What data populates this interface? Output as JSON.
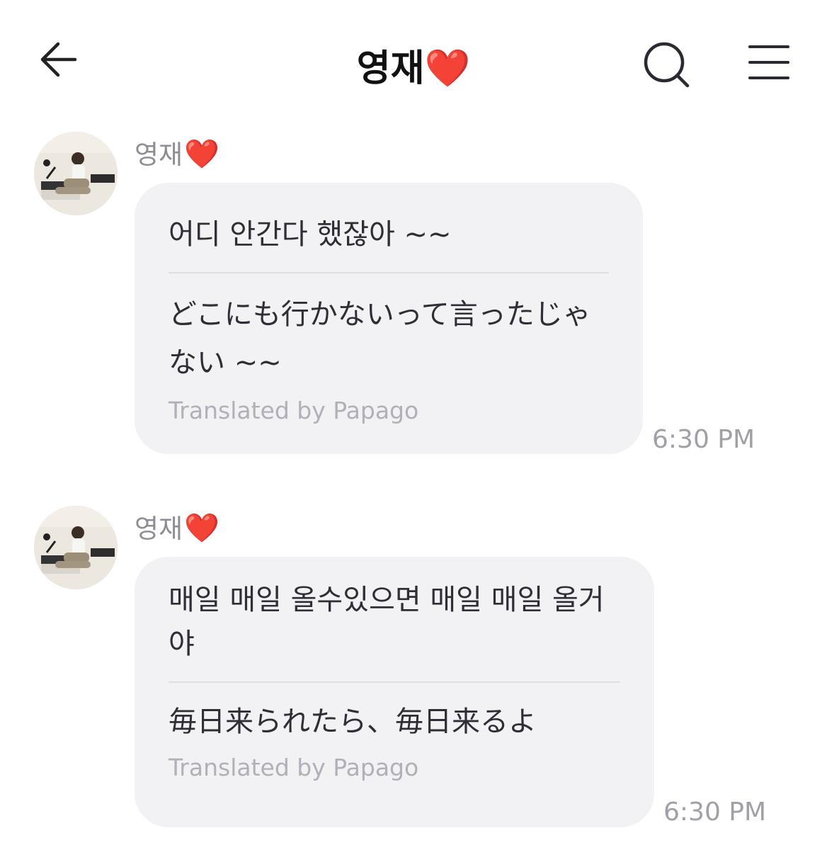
{
  "header": {
    "title": "영재",
    "title_heart": "❤️",
    "back_icon": "arrow-left",
    "search_icon": "search",
    "menu_icon": "hamburger-menu"
  },
  "messages": [
    {
      "sender_name": "영재",
      "sender_heart": "❤️",
      "original": "어디 안간다 했잖아 ~~",
      "translation": "どこにも行かないって言ったじゃない ~~",
      "credit": "Translated by Papago",
      "time": "6:30 PM"
    },
    {
      "sender_name": "영재",
      "sender_heart": "❤️",
      "original": "매일 매일 올수있으면 매일 매일 올거야",
      "translation": "毎日来られたら、毎日来るよ",
      "credit": "Translated by Papago",
      "time": "6:30 PM"
    }
  ],
  "colors": {
    "bubble": "#f2f2f5",
    "heart": "#e5101c",
    "muted_text": "#8d8d95"
  }
}
